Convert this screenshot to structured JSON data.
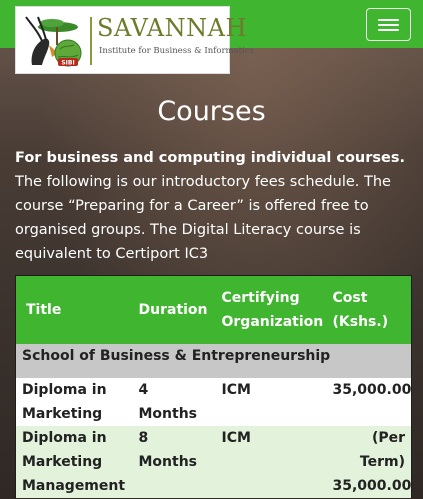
{
  "brand": {
    "name": "SAVANNAH",
    "tagline": "Institute for Business & Informatics",
    "mark_text": "SIBI"
  },
  "nav": {
    "menu_icon": "hamburger-menu-icon"
  },
  "page": {
    "heading": "Courses",
    "intro_bold": "For business and computing individual courses.",
    "intro_rest": " The following is our introductory fees schedule. The course “Preparing for a Career” is offered free to organised groups. The Digital Literacy course is equivalent to Certiport IC3"
  },
  "table": {
    "headers": [
      "Title",
      "Duration",
      "Certifying Organization",
      "Cost (Kshs.)"
    ],
    "section": "School of Business & Entrepreneurship",
    "rows": [
      {
        "title": "Diploma in Marketing",
        "duration": "4 Months",
        "org": "ICM",
        "cost": "35,000.00"
      },
      {
        "title": "Diploma in Marketing Management",
        "duration": "8 Months",
        "org": "ICM",
        "cost_note": "(Per Term)",
        "cost": "35,000.00"
      }
    ]
  },
  "colors": {
    "brand_green": "#3fb530",
    "olive": "#6e7a2c",
    "row_alt": "#e3f2da",
    "section_gray": "#c7c7c7"
  }
}
